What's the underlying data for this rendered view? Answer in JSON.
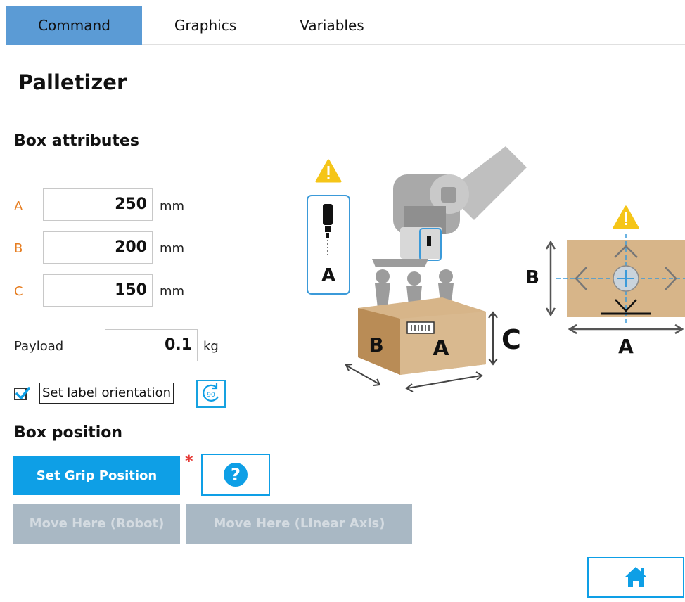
{
  "tabs": [
    {
      "label": "Command",
      "active": true
    },
    {
      "label": "Graphics",
      "active": false
    },
    {
      "label": "Variables",
      "active": false
    }
  ],
  "page_title": "Palletizer",
  "box_attributes": {
    "heading": "Box attributes",
    "fields": [
      {
        "letter": "A",
        "value": "250",
        "unit": "mm"
      },
      {
        "letter": "B",
        "value": "200",
        "unit": "mm"
      },
      {
        "letter": "C",
        "value": "150",
        "unit": "mm"
      }
    ],
    "payload": {
      "label": "Payload",
      "value": "0.1",
      "unit": "kg"
    },
    "label_orientation": {
      "label": "Set label orientation",
      "checked": true
    }
  },
  "box_position": {
    "heading": "Box position",
    "set_grip_label": "Set Grip Position",
    "required_marker": "*",
    "move_robot_label": "Move Here (Robot)",
    "move_linear_label": "Move Here (Linear Axis)"
  },
  "illustration": {
    "gripper_letter": "A",
    "box_letter_a": "A",
    "box_letter_b": "B",
    "box_letter_c": "C",
    "top_view_letter_a": "A",
    "top_view_letter_b": "B",
    "rotate_badge": "90"
  },
  "colors": {
    "accent": "#0e9fe6",
    "tab_active": "#5b9bd5",
    "dimension_letter": "#e67e22",
    "warning": "#f5c518",
    "disabled": "#a9b8c4"
  },
  "icons": [
    "warning-icon",
    "rotate-icon",
    "help-icon",
    "home-icon",
    "checkmark-icon"
  ]
}
